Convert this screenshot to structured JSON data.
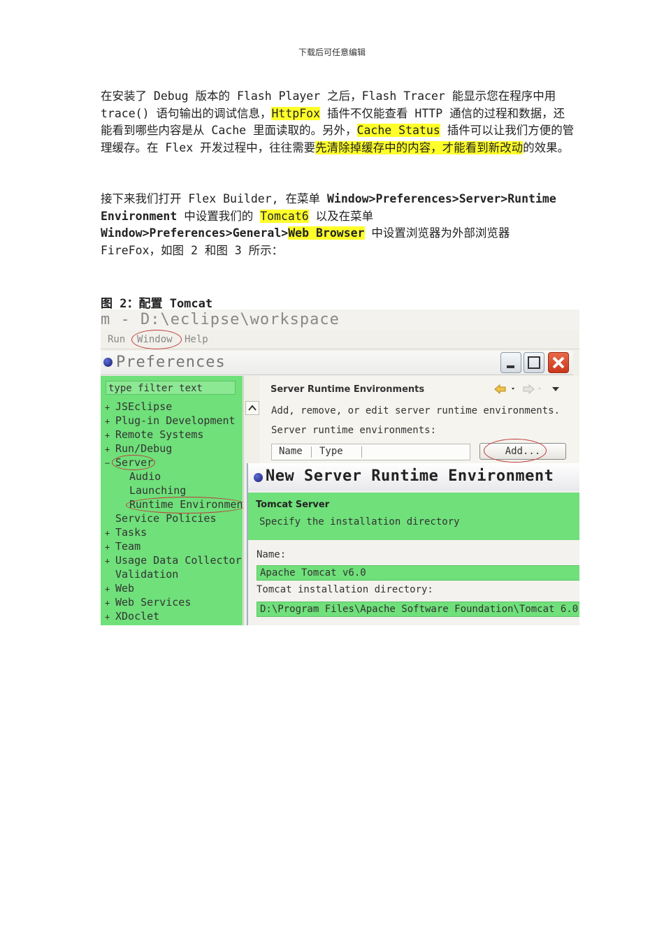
{
  "header": "下载后可任意编辑",
  "para1": [
    {
      "t": "在安装了 Debug 版本的 Flash Player 之后，Flash Tracer 能显示您在程序中用 trace() 语句输出的调试信息，"
    },
    {
      "t": "HttpFox",
      "hl": true
    },
    {
      "t": " 插件不仅能查看 HTTP 通信的过程和数据，还能看到哪些内容是从 Cache 里面读取的。另外，"
    },
    {
      "t": "Cache Status",
      "hl": true
    },
    {
      "t": " 插件可以让我们方便的管理缓存。在 Flex 开发过程中，往往需要"
    },
    {
      "t": "先清除掉缓存中的内容，才能看到新改动",
      "hl": true
    },
    {
      "t": "的效果。"
    }
  ],
  "para2": [
    {
      "t": "接下来我们打开 Flex Builder, 在菜单 "
    },
    {
      "t": "Window>Preferences>Server>Runtime Environment",
      "bold": true
    },
    {
      "t": " 中设置我们的 "
    },
    {
      "t": "Tomcat6",
      "hl": true
    },
    {
      "t": " 以及在菜单 "
    },
    {
      "t": "Window>Preferences>General>",
      "bold": true
    },
    {
      "t": "Web Browser",
      "bold": true,
      "hl": true
    },
    {
      "t": " 中设置浏览器为外部浏览器 FireFox，如图 2 和图 3 所示："
    }
  ],
  "figure_caption": "图 2：配置 Tomcat",
  "screenshot": {
    "title": "m - D:\\eclipse\\workspace",
    "menu": [
      "Run",
      "Window",
      "Help"
    ],
    "pref_title": "Preferences",
    "filter_placeholder": "type filter text",
    "tree": [
      {
        "label": "JSEclipse",
        "exp": "+"
      },
      {
        "label": "Plug-in Development",
        "exp": "+"
      },
      {
        "label": "Remote Systems",
        "exp": "+"
      },
      {
        "label": "Run/Debug",
        "exp": "+"
      },
      {
        "label": "Server",
        "exp": "−"
      },
      {
        "label": "Audio",
        "exp": ""
      },
      {
        "label": "Launching",
        "exp": ""
      },
      {
        "label": "Runtime Environments",
        "exp": ""
      },
      {
        "label": "Service Policies",
        "exp": ""
      },
      {
        "label": "Tasks",
        "exp": "+"
      },
      {
        "label": "Team",
        "exp": "+"
      },
      {
        "label": "Usage Data Collector",
        "exp": "+"
      },
      {
        "label": "Validation",
        "exp": ""
      },
      {
        "label": "Web",
        "exp": "+"
      },
      {
        "label": "Web Services",
        "exp": "+"
      },
      {
        "label": "XDoclet",
        "exp": "+"
      }
    ],
    "server_header": "Server Runtime Environments",
    "server_desc": "Add, remove, or edit server runtime environments.",
    "server_label": "Server runtime environments:",
    "col_name": "Name",
    "col_type": "Type",
    "add_label": "Add...",
    "dialog": {
      "title": "New Server Runtime Environment",
      "header": "Tomcat Server",
      "desc": "Specify the installation directory",
      "name_label": "Name:",
      "name_value": "Apache Tomcat v6.0",
      "dir_label": "Tomcat installation directory:",
      "dir_value": "D:\\Program Files\\Apache Software Foundation\\Tomcat 6.0"
    }
  }
}
